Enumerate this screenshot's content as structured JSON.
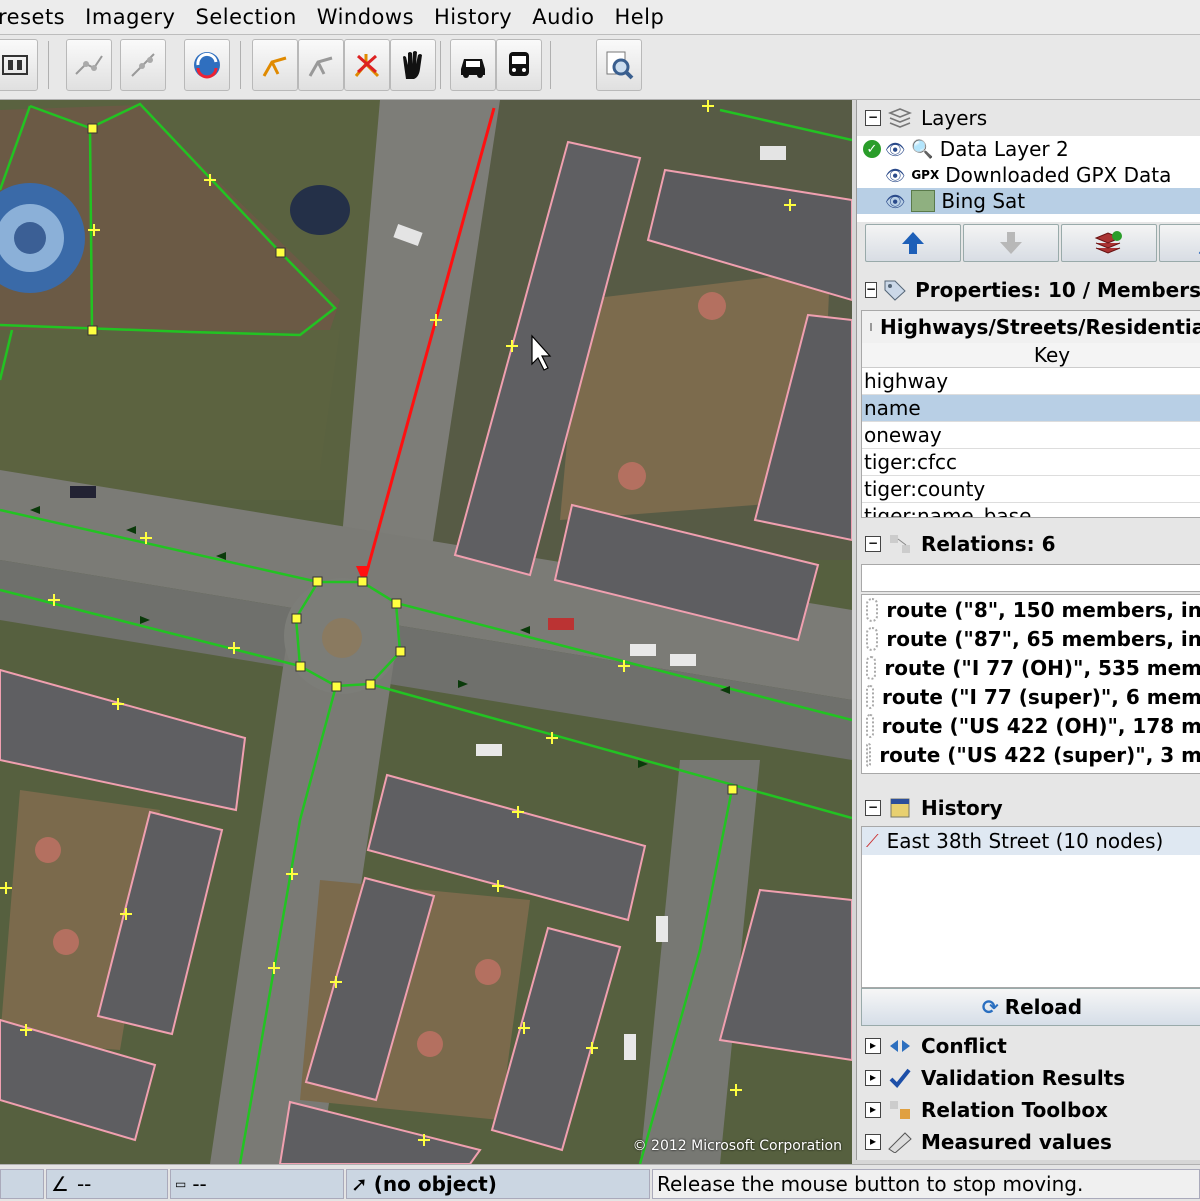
{
  "menu": [
    "resets",
    "Imagery",
    "Selection",
    "Windows",
    "History",
    "Audio",
    "Help"
  ],
  "map": {
    "copyright": "© 2012 Microsoft Corporation"
  },
  "layers": {
    "title": "Layers",
    "items": [
      {
        "label": "Data Layer 2",
        "prefix": ""
      },
      {
        "label": "Downloaded GPX Data",
        "prefix": "GPX"
      },
      {
        "label": "Bing Sat",
        "prefix": ""
      }
    ]
  },
  "properties": {
    "title": "Properties: 10 / Members",
    "preset": "Highways/Streets/Residential",
    "column_key": "Key",
    "keys": [
      "highway",
      "name",
      "oneway",
      "tiger:cfcc",
      "tiger:county",
      "tiger:name_base"
    ]
  },
  "relations": {
    "title": "Relations: 6",
    "items": [
      "route (\"8\", 150 members, in",
      "route (\"87\", 65 members, in",
      "route (\"I 77 (OH)\", 535 mem",
      "route (\"I 77 (super)\", 6 mem",
      "route (\"US 422 (OH)\", 178 m",
      "route (\"US 422 (super)\", 3 m"
    ]
  },
  "history": {
    "title": "History",
    "items": [
      "East 38th Street (10 nodes)"
    ],
    "reload_label": "Reload"
  },
  "collapsed_panels": [
    "Conflict",
    "Validation Results",
    "Relation Toolbox",
    "Measured values"
  ],
  "status": {
    "angle": "--",
    "length": "--",
    "object": "(no object)",
    "message": "Release the mouse button to stop moving."
  }
}
